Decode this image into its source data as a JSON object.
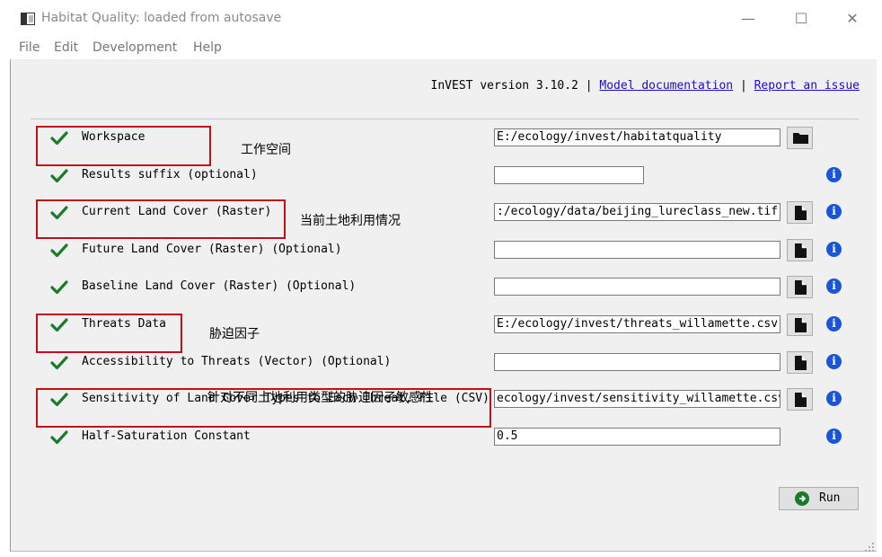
{
  "window": {
    "title": "Habitat Quality: loaded from autosave",
    "minimize": "—",
    "maximize": "☐",
    "close": "✕"
  },
  "menu": [
    "File",
    "Edit",
    "Development",
    "Help"
  ],
  "header": {
    "version_text": "InVEST version 3.10.2",
    "separator": "|",
    "doc_link": "Model documentation",
    "issue_link": "Report an issue",
    "link_color": "#1a0dcc"
  },
  "icons": {
    "check": "check-icon",
    "folder": "folder-icon",
    "file": "file-icon",
    "info": "info-icon",
    "run": "play-icon"
  },
  "colors": {
    "check": "#1b7a2b",
    "info": "#1a55d6",
    "annotation": "#c0101a"
  },
  "rows": [
    {
      "label": "Workspace",
      "value": "E:/ecology/invest/habitatquality",
      "button": "folder"
    },
    {
      "label": "Results suffix (optional)",
      "value": "",
      "button": "none"
    },
    {
      "label": "Current Land Cover (Raster)",
      "value": ":/ecology/data/beijing_lureclass_new.tif",
      "button": "file"
    },
    {
      "label": "Future Land Cover (Raster) (Optional)",
      "value": "",
      "button": "file"
    },
    {
      "label": "Baseline Land Cover (Raster) (Optional)",
      "value": "",
      "button": "file"
    },
    {
      "label": "Threats Data",
      "value": "E:/ecology/invest/threats_willamette.csv",
      "button": "file"
    },
    {
      "label": "Accessibility to Threats (Vector) (Optional)",
      "value": "",
      "button": "file"
    },
    {
      "label": "Sensitivity of Land Cover Types to Each Threat, File (CSV)",
      "value": "ecology/invest/sensitivity_willamette.csv",
      "button": "file"
    },
    {
      "label": "Half-Saturation Constant",
      "value": "0.5",
      "button": "none"
    }
  ],
  "annotations": {
    "workspace": "工作空间",
    "land_cover": "当前土地利用情况",
    "threats": "胁迫因子",
    "sensitivity": "针对不同土地利用类型的胁迫因子敏感性"
  },
  "run_label": "Run"
}
